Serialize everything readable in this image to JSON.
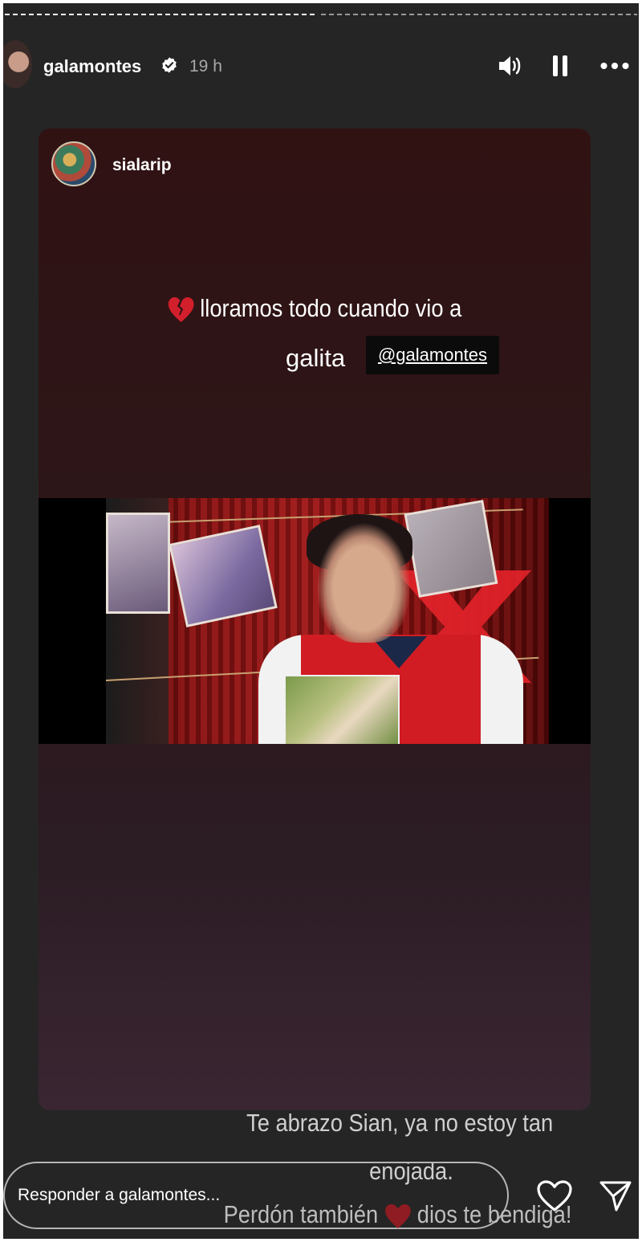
{
  "header": {
    "username": "galamontes",
    "time": "19 h"
  },
  "story": {
    "source_username": "sialarip",
    "caption_line1": "lloramos todo cuando vio a",
    "caption_line2": "galita",
    "mention": "@galamontes"
  },
  "overlay_text": {
    "line1": "Te abrazo Sian, ya no estoy tan",
    "line2": "enojada.",
    "line3_before": "Perdón también",
    "line3_after": "dios te bendiga!"
  },
  "reply": {
    "placeholder": "Responder a galamontes..."
  },
  "icons": [
    "volume-icon",
    "pause-icon",
    "more-icon",
    "verified-icon",
    "broken-heart-icon",
    "heart-icon",
    "send-icon"
  ],
  "colors": {
    "background": "#252525",
    "card_top": "#301213",
    "card_bottom": "#3a2632",
    "mention_bg": "#0b0b0b",
    "accent_heart": "#8e1c22"
  }
}
